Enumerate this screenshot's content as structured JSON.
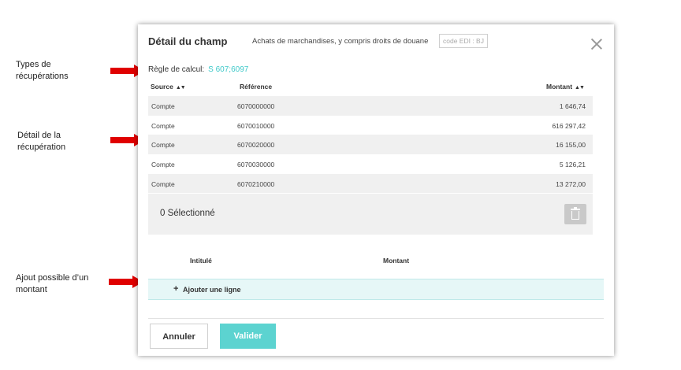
{
  "annotations": [
    {
      "line1": "Types de",
      "line2": "récupérations"
    },
    {
      "line1": "Détail de la",
      "line2": "récupération"
    },
    {
      "line1": "Ajout possible d’un",
      "line2": "montant"
    }
  ],
  "modal": {
    "title": "Détail du champ",
    "subtitle": "Achats de marchandises, y compris droits de douane",
    "code_badge": "code EDI : BJ",
    "rule_label": "Règle de calcul:",
    "rule_value": "S 607;6097",
    "columns": {
      "source": "Source",
      "reference": "Référence",
      "amount": "Montant"
    },
    "rows": [
      {
        "source": "Compte",
        "reference": "6070000000",
        "amount": "1 646,74"
      },
      {
        "source": "Compte",
        "reference": "6070010000",
        "amount": "616 297,42"
      },
      {
        "source": "Compte",
        "reference": "6070020000",
        "amount": "16 155,00"
      },
      {
        "source": "Compte",
        "reference": "6070030000",
        "amount": "5 126,21"
      },
      {
        "source": "Compte",
        "reference": "6070210000",
        "amount": "13 272,00"
      }
    ],
    "selected_text": "0 Sélectionné",
    "add_section": {
      "label_col": "Intitulé",
      "amount_col": "Montant",
      "add_line": "Ajouter une ligne",
      "plus": "+"
    },
    "buttons": {
      "cancel": "Annuler",
      "ok": "Valider"
    }
  },
  "icons": {
    "close": "close-icon",
    "trash": "trash-icon",
    "sort": "sort-icon"
  },
  "colors": {
    "accent": "#5cd3d0",
    "rule_value": "#3ec9c9",
    "arrow": "#e00000"
  }
}
